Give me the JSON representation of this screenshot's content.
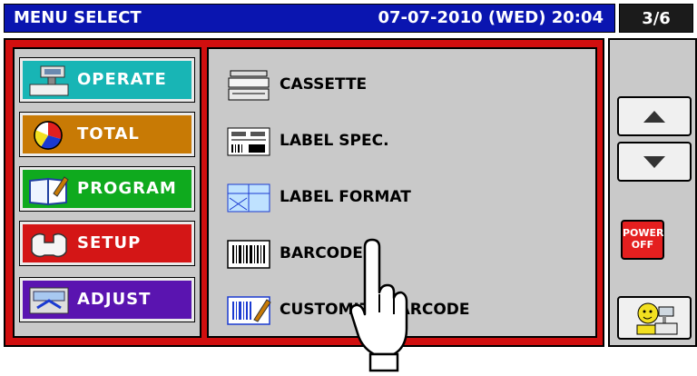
{
  "header": {
    "title": "MENU SELECT",
    "datetime": "07-07-2010 (WED) 20:04",
    "page_indicator": "3/6",
    "bg_color": "#0a15b0"
  },
  "menu": [
    {
      "label": "OPERATE",
      "icon": "scale-icon",
      "color": "#18b5b5"
    },
    {
      "label": "TOTAL",
      "icon": "pie-chart-icon",
      "color": "#c87a05"
    },
    {
      "label": "PROGRAM",
      "icon": "book-icon",
      "color": "#0faa1e"
    },
    {
      "label": "SETUP",
      "icon": "wrench-icon",
      "color": "#d41616"
    },
    {
      "label": "ADJUST",
      "icon": "adjust-scale-icon",
      "color": "#5a14b0"
    }
  ],
  "items": [
    {
      "label": "CASSETTE",
      "icon": "cassette-icon"
    },
    {
      "label": "LABEL SPEC.",
      "icon": "label-spec-icon"
    },
    {
      "label": "LABEL FORMAT",
      "icon": "label-format-icon"
    },
    {
      "label": "BARCODE",
      "icon": "barcode-icon"
    },
    {
      "label": "CUSTOMIZE BARCODE",
      "icon": "customize-barcode-icon"
    }
  ],
  "side": {
    "up": "up-arrow-icon",
    "down": "down-arrow-icon",
    "power_line1": "POWER",
    "power_line2": "OFF",
    "operator": "operator-icon"
  }
}
